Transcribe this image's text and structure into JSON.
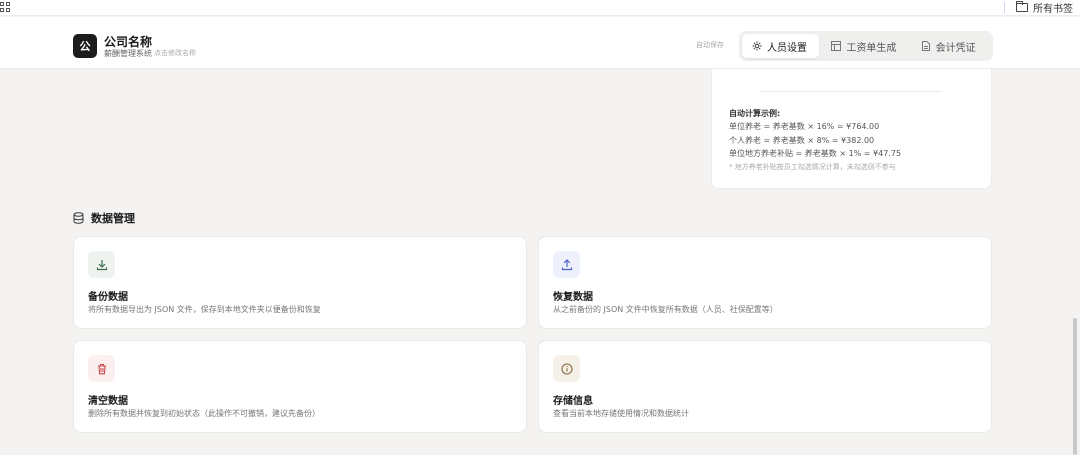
{
  "browser": {
    "bookmarks_folder_label": "所有书签",
    "icons": {
      "apps": "apps-grid-icon",
      "folder": "folder-icon"
    }
  },
  "header": {
    "logo_text": "公",
    "company_name": "公司名称",
    "system_name": "薪酬管理系统",
    "rename_hint": "点击修改名称",
    "autosave_label": "自动保存",
    "tabs": [
      {
        "label": "人员设置",
        "icon": "gear-icon",
        "active": true
      },
      {
        "label": "工资单生成",
        "icon": "table-icon",
        "active": false
      },
      {
        "label": "会计凭证",
        "icon": "document-icon",
        "active": false
      }
    ]
  },
  "calc_example": {
    "title": "自动计算示例:",
    "lines": [
      "单位养老 = 养老基数 × 16% = ¥764.00",
      "个人养老 = 养老基数 × 8% = ¥382.00",
      "单位地方养老补贴 = 养老基数 × 1% = ¥47.75"
    ],
    "note": "* 地方养老补贴按员工勾选情况计算，未勾选则不参与"
  },
  "data_management": {
    "title": "数据管理",
    "icon": "database-icon",
    "cards": [
      {
        "title": "备份数据",
        "description": "将所有数据导出为 JSON 文件，保存到本地文件夹以便备份和恢复",
        "icon": "download-icon",
        "icon_bg": "#eef3ef",
        "icon_color": "#3b6e4e"
      },
      {
        "title": "恢复数据",
        "description": "从之前备份的 JSON 文件中恢复所有数据（人员、社保配置等）",
        "icon": "upload-icon",
        "icon_bg": "#eef1fb",
        "icon_color": "#4a63c7"
      },
      {
        "title": "清空数据",
        "description": "删除所有数据并恢复到初始状态（此操作不可撤销，建议先备份）",
        "icon": "trash-icon",
        "icon_bg": "#fcefef",
        "icon_color": "#c94a4a"
      },
      {
        "title": "存储信息",
        "description": "查看当前本地存储使用情况和数据统计",
        "icon": "info-icon",
        "icon_bg": "#f6f1e8",
        "icon_color": "#8a6a3a"
      }
    ]
  }
}
